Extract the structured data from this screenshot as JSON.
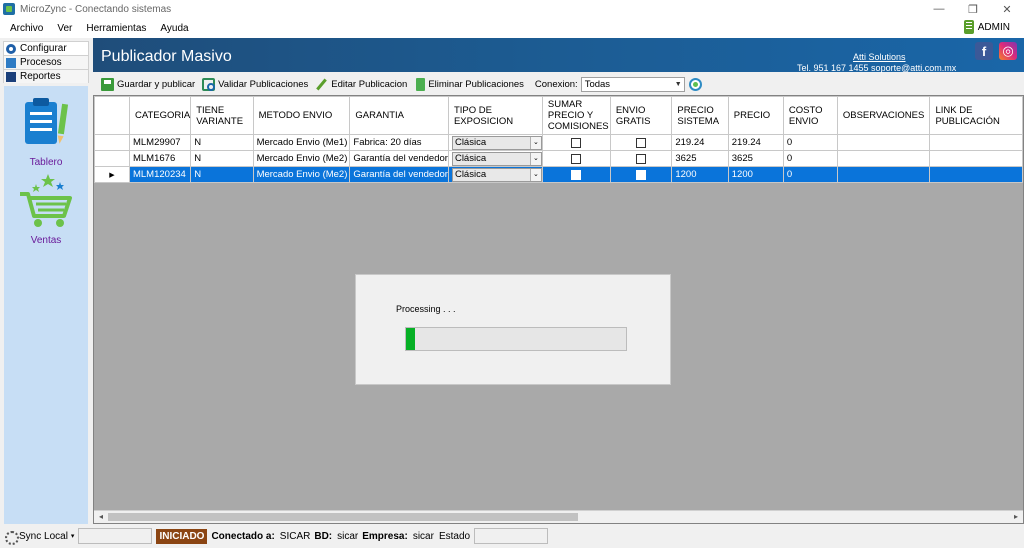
{
  "window": {
    "title": "MicroZync - Conectando sistemas",
    "controls": [
      "—",
      "❐",
      "✕"
    ]
  },
  "menu": {
    "items": [
      "Archivo",
      "Ver",
      "Herramientas",
      "Ayuda"
    ],
    "user": "ADMIN"
  },
  "nav": {
    "tabs": [
      "Configurar",
      "Procesos",
      "Reportes"
    ],
    "cards": [
      "Tablero",
      "Ventas"
    ]
  },
  "header": {
    "title": "Publicador Masivo",
    "company_link": "Atti Solutions",
    "contact": "Tel. 951 167 1455  soporte@atti.com.mx",
    "facebook_glyph": "f",
    "instagram_glyph": "◎"
  },
  "toolbar": {
    "save": "Guardar y publicar",
    "validate": "Validar Publicaciones",
    "edit": "Editar Publicacion",
    "delete": "Eliminar Publicaciones",
    "conexion_label": "Conexion:",
    "conexion_value": "Todas"
  },
  "grid": {
    "columns": [
      "CATEGORIA",
      "TIENE VARIANTE",
      "METODO ENVIO",
      "GARANTIA",
      "TIPO DE EXPOSICION",
      "SUMAR PRECIO Y COMISIONES",
      "ENVIO GRATIS",
      "PRECIO SISTEMA",
      "PRECIO",
      "COSTO ENVIO",
      "OBSERVACIONES",
      "LINK DE PUBLICACIÓN"
    ],
    "rows": [
      {
        "marker": "",
        "categoria": "MLM29907",
        "variante": "N",
        "metodo": "Mercado Envio (Me1)",
        "garantia": "Fabrica: 20 días",
        "exposicion": "Clásica",
        "sumar": false,
        "envio_gratis": false,
        "precio_sistema": "219.24",
        "precio": "219.24",
        "costo_envio": "0",
        "observaciones": "",
        "link": ""
      },
      {
        "marker": "",
        "categoria": "MLM1676",
        "variante": "N",
        "metodo": "Mercado Envio (Me2)",
        "garantia": "Garantía del vendedor",
        "exposicion": "Clásica",
        "sumar": false,
        "envio_gratis": false,
        "precio_sistema": "3625",
        "precio": "3625",
        "costo_envio": "0",
        "observaciones": "",
        "link": ""
      },
      {
        "marker": "▶",
        "categoria": "MLM120234",
        "variante": "N",
        "metodo": "Mercado Envio (Me2)",
        "garantia": "Garantía del vendedor",
        "exposicion": "Clásica",
        "sumar": false,
        "envio_gratis": false,
        "precio_sistema": "1200",
        "precio": "1200",
        "costo_envio": "0",
        "observaciones": "",
        "link": ""
      }
    ],
    "selected_row": 2,
    "scroll_left": "◂",
    "scroll_right": "▸",
    "combo_arrow": "⌄"
  },
  "dialog": {
    "text": "Processing . . .",
    "progress": 0.04,
    "progress_color": "#06b025"
  },
  "status": {
    "sync_label": "Sync Local",
    "sync_arrow": "▾",
    "badge": "INICIADO",
    "connected_label": "Conectado a:",
    "connected_value": "SICAR",
    "bd_label": "BD:",
    "bd_value": "sicar",
    "empresa_label": "Empresa:",
    "empresa_value": "sicar",
    "estado_label": "Estado"
  },
  "colors": {
    "header_blue": "#1c5c93",
    "selection": "#0a74da",
    "nav_panel": "#c7def5",
    "badge": "#8b4513"
  }
}
